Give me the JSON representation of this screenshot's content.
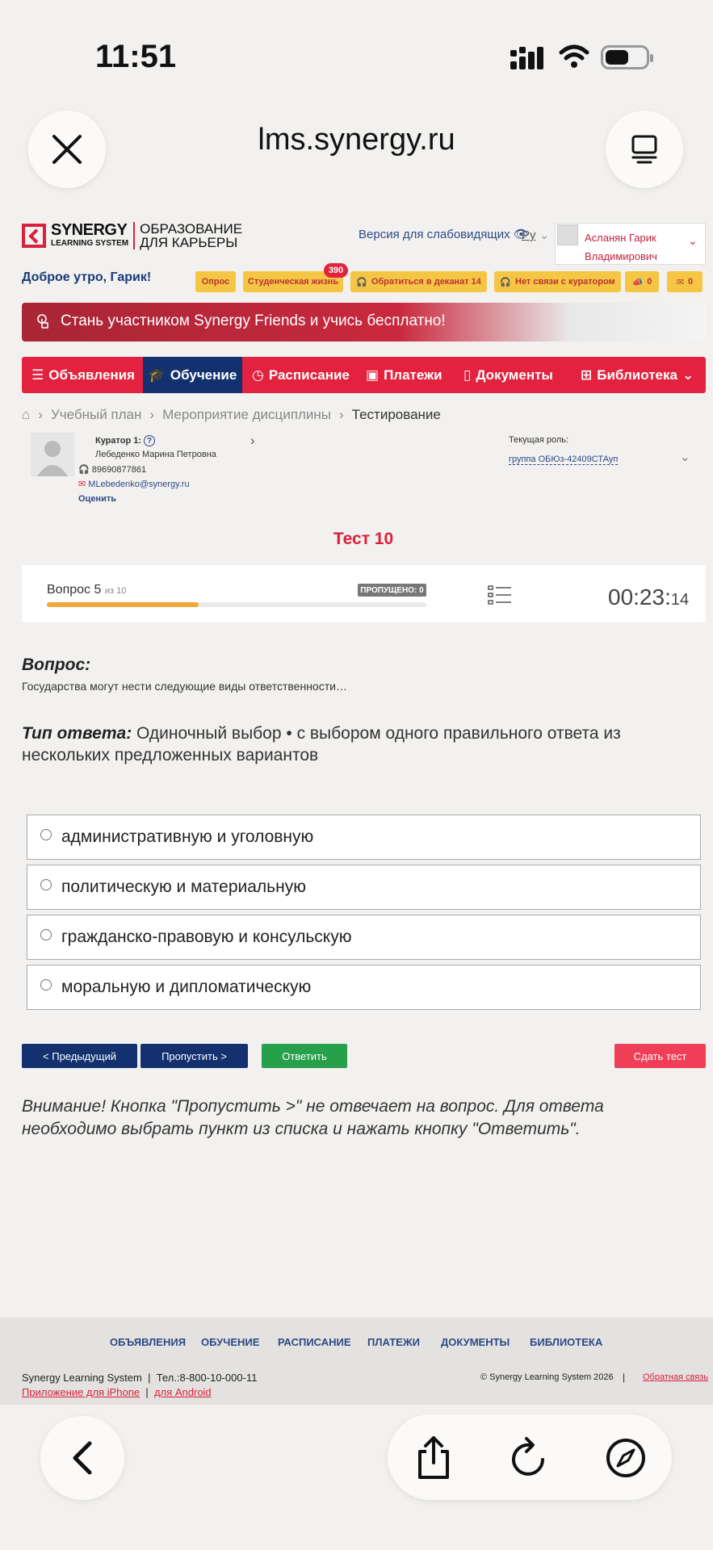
{
  "status": {
    "time": "11:51"
  },
  "browser": {
    "url": "lms.synergy.ru"
  },
  "logo": {
    "line1": "SYNERGY",
    "line2": "LEARNING SYSTEM",
    "tag1": "ОБРАЗОВАНИЕ",
    "tag2": "ДЛЯ КАРЬЕРЫ"
  },
  "header": {
    "vision_version": "Версия для слабовидящих",
    "lang": "Ру",
    "user_line1": "Асланян Гарик",
    "user_line2": "Владимирович",
    "greeting": "Доброе утро, Гарик!"
  },
  "pills": {
    "survey": "Опрос",
    "student_life": "Студенческая жизнь",
    "student_life_badge": "390",
    "dean": "Обратиться в деканат 14",
    "curator": "Нет связи с куратором",
    "promo_count": "0",
    "mail_count": "0"
  },
  "banner": {
    "text": "Стань участником Synergy Friends и учись бесплатно!"
  },
  "nav": {
    "announcements": "Объявления",
    "learning": "Обучение",
    "schedule": "Расписание",
    "payments": "Платежи",
    "documents": "Документы",
    "library": "Библиотека"
  },
  "breadcrumb": {
    "plan": "Учебный план",
    "event": "Мероприятие дисциплины",
    "current": "Тестирование"
  },
  "curator": {
    "label": "Куратор 1:",
    "name": "Лебеденко Марина Петровна",
    "phone": "89690877861",
    "email": "MLebedenko@synergy.ru",
    "rate": "Оценить",
    "role_label": "Текущая роль:",
    "role_value": "группа ОБЮз-42409СТАуп"
  },
  "test": {
    "title": "Тест 10",
    "question_word": "Вопрос 5",
    "question_of": "из 10",
    "skipped": "ПРОПУЩЕНО: 0",
    "progress": 0.4,
    "timer_main": "00:23:",
    "timer_sec": "14"
  },
  "question": {
    "label": "Вопрос:",
    "text": "Государства могут нести следующие виды ответственности…",
    "type_label": "Тип ответа:",
    "type_text": " Одиночный выбор • с выбором одного правильного ответа из нескольких предложенных вариантов"
  },
  "options": [
    "административную и уголовную",
    "политическую и материальную",
    "гражданско-правовую и консульскую",
    "моральную и дипломатическую"
  ],
  "buttons": {
    "prev": "< Предыдущий",
    "skip": "Пропустить >",
    "answer": "Ответить",
    "submit": "Сдать тест"
  },
  "note": "Внимание! Кнопка \"Пропустить >\" не отвечает на вопрос. Для ответа необходимо выбрать пункт из списка и нажать кнопку \"Ответить\".",
  "footer": {
    "nav": [
      "ОБЪЯВЛЕНИЯ",
      "ОБУЧЕНИЕ",
      "РАСПИСАНИЕ",
      "ПЛАТЕЖИ",
      "ДОКУМЕНТЫ",
      "БИБЛИОТЕКА"
    ],
    "company": "Synergy Learning System",
    "sep": "|",
    "phone": "Тел.:8-800-10-000-11",
    "iphone": "Приложение для iPhone",
    "android": "для Android",
    "copyright": "© Synergy Learning System 2026",
    "feedback": "Обратная связь"
  }
}
